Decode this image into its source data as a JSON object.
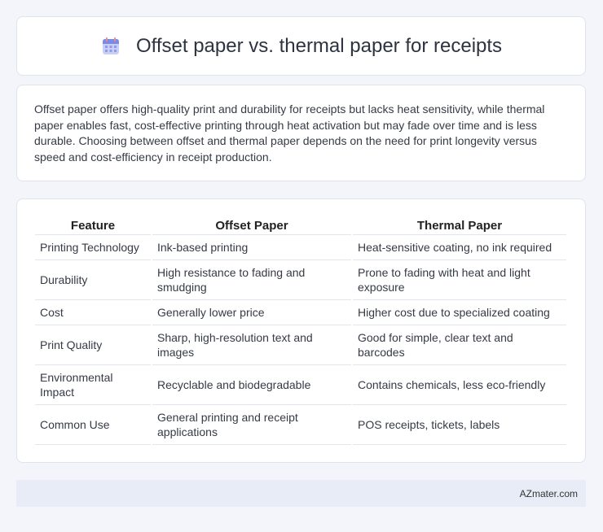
{
  "header": {
    "title": "Offset paper vs. thermal paper for receipts",
    "icon": "calendar-icon"
  },
  "summary": {
    "text": "Offset paper offers high-quality print and durability for receipts but lacks heat sensitivity, while thermal paper enables fast, cost-effective printing through heat activation but may fade over time and is less durable. Choosing between offset and thermal paper depends on the need for print longevity versus speed and cost-efficiency in receipt production."
  },
  "table": {
    "headers": [
      "Feature",
      "Offset Paper",
      "Thermal Paper"
    ],
    "rows": [
      [
        "Printing Technology",
        "Ink-based printing",
        "Heat-sensitive coating, no ink required"
      ],
      [
        "Durability",
        "High resistance to fading and smudging",
        "Prone to fading with heat and light exposure"
      ],
      [
        "Cost",
        "Generally lower price",
        "Higher cost due to specialized coating"
      ],
      [
        "Print Quality",
        "Sharp, high-resolution text and images",
        "Good for simple, clear text and barcodes"
      ],
      [
        "Environmental Impact",
        "Recyclable and biodegradable",
        "Contains chemicals, less eco-friendly"
      ],
      [
        "Common Use",
        "General printing and receipt applications",
        "POS receipts, tickets, labels"
      ]
    ]
  },
  "footer": {
    "brand": "AZmater.com"
  },
  "colors": {
    "background": "#f3f5fa",
    "card": "#ffffff",
    "footer": "#e7ecf7",
    "icon_accent": "#7b8ce0"
  }
}
